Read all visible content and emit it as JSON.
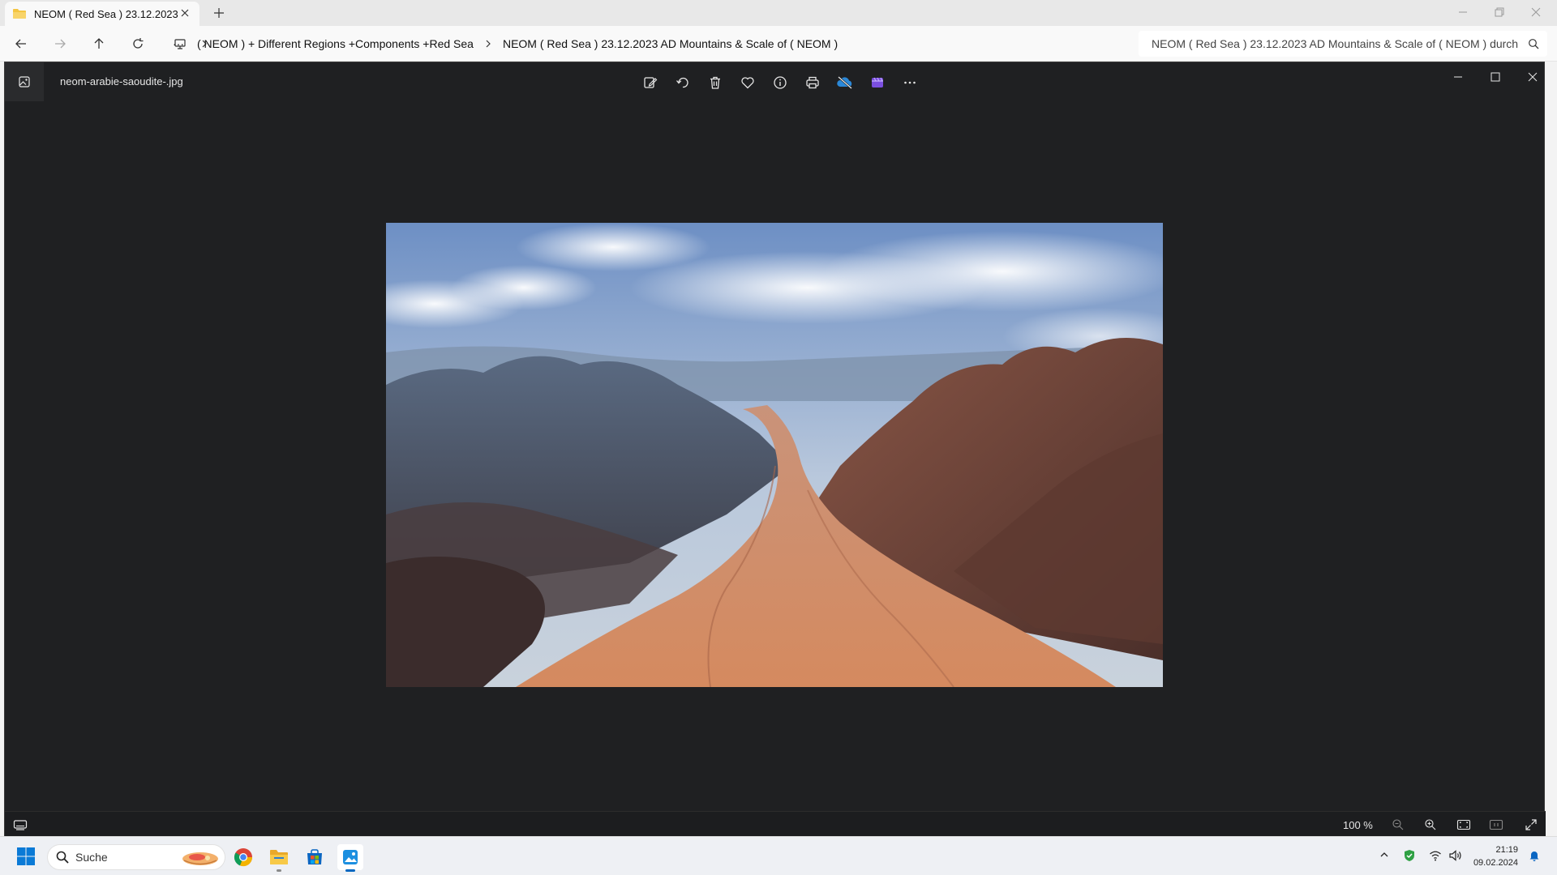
{
  "explorer": {
    "tab_title": "NEOM ( Red Sea )  23.12.2023",
    "breadcrumb": {
      "overflow": "···",
      "segments": [
        "( NEOM ) + Different Regions +Components +Red Sea",
        "NEOM ( Red Sea )  23.12.2023 AD Mountains & Scale of ( NEOM )"
      ]
    },
    "search_text": "NEOM ( Red Sea )  23.12.2023 AD Mountains & Scale of ( NEOM ) durch"
  },
  "viewer": {
    "filename": "neom-arabie-saoudite-.jpg",
    "toolbar_icons": [
      "edit-icon",
      "rotate-icon",
      "delete-icon",
      "favorite-icon",
      "info-icon",
      "print-icon",
      "onedrive-icon",
      "clipchamp-icon",
      "more-icon"
    ],
    "zoom": "100 %"
  },
  "taskbar": {
    "search_label": "Suche",
    "time": "21:19",
    "date": "09.02.2024",
    "apps": [
      "chrome-icon",
      "file-explorer-icon",
      "microsoft-store-icon",
      "photos-icon"
    ]
  },
  "colors": {
    "viewer_bg": "#1f2022",
    "accent": "#0067c0",
    "folder": "#f4c542"
  }
}
